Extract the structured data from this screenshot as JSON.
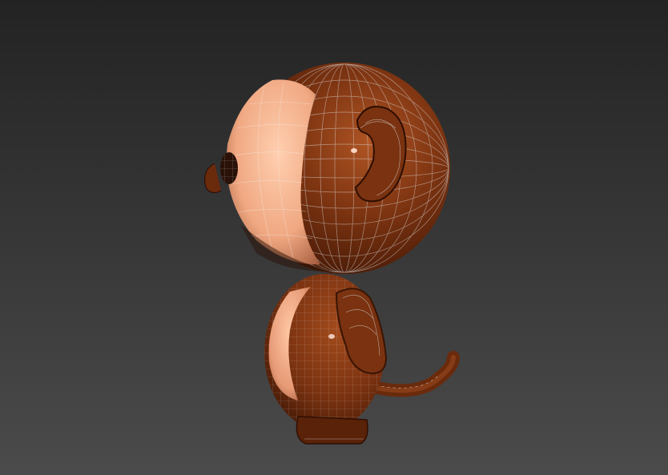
{
  "viewport": {
    "background_top": "#232323",
    "background_bottom": "#4b4b4b",
    "wireframe_color": "#c8c8c8"
  },
  "model": {
    "subject": "monkey-character",
    "colors": {
      "fur": "#7a3210",
      "fur_highlight": "#a24a1c",
      "fur_shadow": "#3a1404",
      "skin": "#f0b08e",
      "skin_shadow": "#c07a58"
    }
  }
}
